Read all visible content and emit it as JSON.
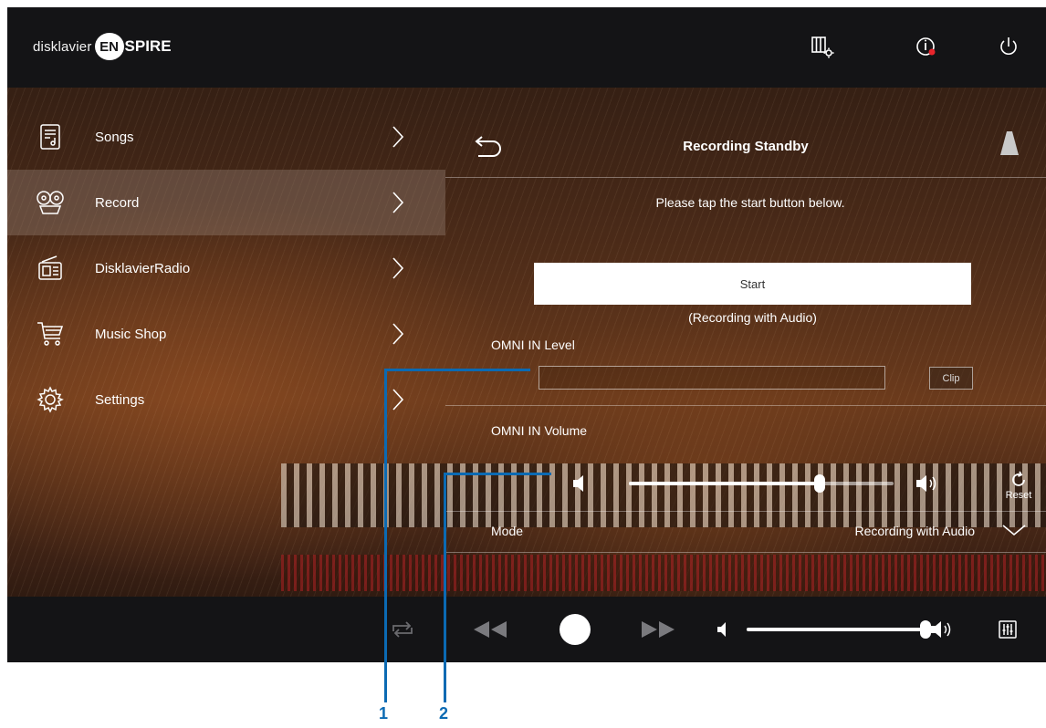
{
  "header": {
    "logo_word": "disklavier",
    "logo_badge": "EN",
    "logo_tail": "SPIRE",
    "icons": [
      "piano-settings-icon",
      "info-icon",
      "power-icon"
    ],
    "info_dot_color": "#e8252c"
  },
  "sidebar": {
    "items": [
      {
        "label": "Songs",
        "icon": "songs-icon",
        "active": false
      },
      {
        "label": "Record",
        "icon": "record-icon",
        "active": true
      },
      {
        "label": "DisklavierRadio",
        "icon": "radio-icon",
        "active": false
      },
      {
        "label": "Music Shop",
        "icon": "cart-icon",
        "active": false
      },
      {
        "label": "Settings",
        "icon": "gear-icon",
        "active": false
      }
    ]
  },
  "panel": {
    "title": "Recording Standby",
    "instruction": "Please tap the start button below.",
    "start_label": "Start",
    "start_sublabel": "(Recording with Audio)",
    "omni_level_label": "OMNI IN Level",
    "clip_label": "Clip",
    "omni_volume_label": "OMNI IN Volume",
    "omni_volume_level": 0.72,
    "reset_label": "Reset",
    "mode_label": "Mode",
    "mode_value": "Recording with Audio"
  },
  "transport": {
    "icons": [
      "repeat-icon",
      "rewind-icon",
      "record-button-icon",
      "fast-forward-icon",
      "speaker-low-icon",
      "speaker-high-icon",
      "mixer-icon"
    ],
    "volume_level": 1.0
  },
  "callouts": {
    "one": "1",
    "two": "2",
    "color": "#0b6ab3"
  }
}
